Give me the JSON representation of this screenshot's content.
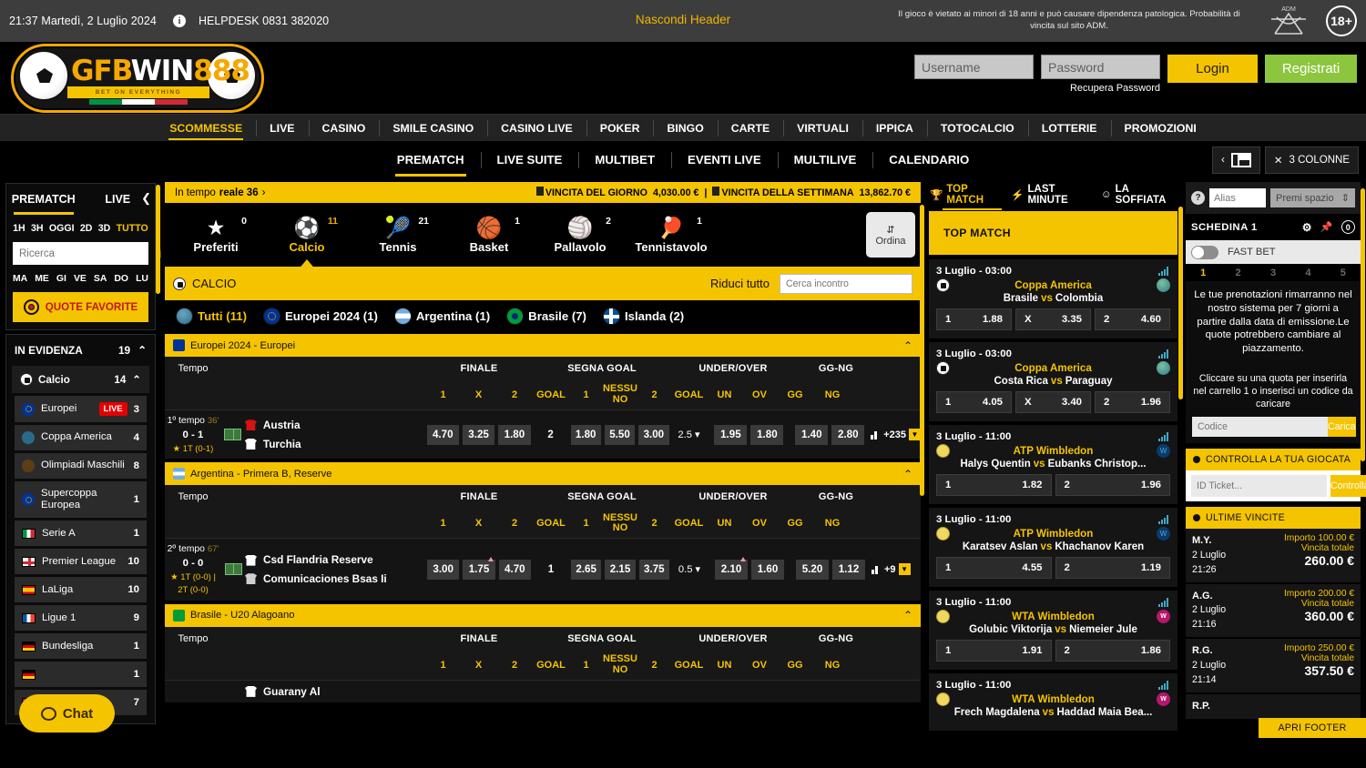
{
  "topbar": {
    "clock": "21:37 Martedì, 2 Luglio 2024",
    "info_icon": "info-icon",
    "helpdesk": "HELPDESK 0831 382020",
    "hide_header": "Nascondi Header",
    "disclaimer": "Il gioco è vietato ai minori di 18 anni e può causare dipendenza patologica. Probabilità di vincita sul sito ADM.",
    "adm_label": "ADM",
    "age_badge": "18+"
  },
  "header": {
    "logo": {
      "part1": "GFB",
      "part2": "WIN",
      "part3": "888",
      "tagline": "BET ON EVERYTHING"
    },
    "login": {
      "username_placeholder": "Username",
      "password_placeholder": "Password",
      "recover": "Recupera Password",
      "login_label": "Login",
      "register_label": "Registrati"
    }
  },
  "mainnav": {
    "items": [
      {
        "label": "SCOMMESSE",
        "active": true
      },
      {
        "label": "LIVE",
        "active": false
      },
      {
        "label": "CASINO",
        "active": false
      },
      {
        "label": "SMILE CASINO",
        "active": false
      },
      {
        "label": "CASINO LIVE",
        "active": false
      },
      {
        "label": "POKER",
        "active": false
      },
      {
        "label": "BINGO",
        "active": false
      },
      {
        "label": "CARTE",
        "active": false
      },
      {
        "label": "VIRTUALI",
        "active": false
      },
      {
        "label": "IPPICA",
        "active": false
      },
      {
        "label": "TOTOCALCIO",
        "active": false
      },
      {
        "label": "LOTTERIE",
        "active": false
      },
      {
        "label": "PROMOZIONI",
        "active": false
      }
    ]
  },
  "subnav": {
    "items": [
      {
        "label": "PREMATCH",
        "active": true
      },
      {
        "label": "LIVE SUITE",
        "active": false
      },
      {
        "label": "MULTIBET",
        "active": false
      },
      {
        "label": "EVENTI LIVE",
        "active": false
      },
      {
        "label": "MULTILIVE",
        "active": false
      },
      {
        "label": "CALENDARIO",
        "active": false
      }
    ],
    "prev_arrow": "‹",
    "layout_icon": "layout-icon",
    "columns_label": "3 COLONNE"
  },
  "sidebar": {
    "tabs": [
      {
        "label": "PREMATCH",
        "active": true
      },
      {
        "label": "LIVE",
        "active": false
      }
    ],
    "collapse_icon": "chevron-left-icon",
    "periods": [
      "1H",
      "3H",
      "OGGI",
      "2D",
      "3D",
      "TUTTO"
    ],
    "period_active": "TUTTO",
    "search_placeholder": "Ricerca",
    "days": [
      "MA",
      "ME",
      "GI",
      "VE",
      "SA",
      "DO",
      "LU"
    ],
    "favorites_label": "QUOTE FAVORITE",
    "highlight_title": "IN EVIDENZA",
    "highlight_count": "19",
    "sport": {
      "label": "Calcio",
      "count": "14"
    },
    "leagues": [
      {
        "label": "Europei",
        "count": "3",
        "tag": "LIVE",
        "flag": "eu"
      },
      {
        "label": "Coppa America",
        "count": "4",
        "tag": "",
        "flag": "globe"
      },
      {
        "label": "Olimpiadi Maschili",
        "count": "8",
        "tag": "",
        "flag": "olym"
      },
      {
        "label": "Supercoppa Europea",
        "count": "1",
        "tag": "",
        "flag": "eu"
      },
      {
        "label": "Serie A",
        "count": "1",
        "tag": "",
        "flag": "it"
      },
      {
        "label": "Premier League",
        "count": "10",
        "tag": "",
        "flag": "en"
      },
      {
        "label": "LaLiga",
        "count": "10",
        "tag": "",
        "flag": "es"
      },
      {
        "label": "Ligue 1",
        "count": "9",
        "tag": "",
        "flag": "fr"
      },
      {
        "label": "Bundesliga",
        "count": "1",
        "tag": "",
        "flag": "de"
      },
      {
        "label": "",
        "count": "1",
        "tag": "",
        "flag": "de"
      },
      {
        "label": "",
        "count": "7",
        "tag": "",
        "flag": "no"
      }
    ],
    "chat_label": "Chat"
  },
  "center": {
    "promo": {
      "live_label": "In tempo",
      "live_bold": "reale 36",
      "live_arrow": "›",
      "daily_label": "VINCITA DEL GIORNO",
      "daily_value": "4,030.00 €",
      "weekly_label": "VINCITA DELLA SETTIMANA",
      "weekly_value": "13,862.70 €"
    },
    "sports": [
      {
        "label": "Preferiti",
        "count": "0",
        "icon": "star-icon",
        "active": false
      },
      {
        "label": "Calcio",
        "count": "11",
        "icon": "soccer-ball-icon",
        "active": true
      },
      {
        "label": "Tennis",
        "count": "21",
        "icon": "tennis-ball-icon",
        "active": false
      },
      {
        "label": "Basket",
        "count": "1",
        "icon": "basketball-icon",
        "active": false
      },
      {
        "label": "Pallavolo",
        "count": "2",
        "icon": "volleyball-icon",
        "active": false
      },
      {
        "label": "Tennistavolo",
        "count": "1",
        "icon": "table-tennis-icon",
        "active": false
      }
    ],
    "sort_label": "Ordina",
    "section_title": "CALCIO",
    "reduce_all": "Riduci tutto",
    "match_search_placeholder": "Cerca incontro",
    "countries": [
      {
        "label": "Tutti (11)",
        "flag": "world",
        "active": true
      },
      {
        "label": "Europei 2024 (1)",
        "flag": "eu",
        "active": false
      },
      {
        "label": "Argentina (1)",
        "flag": "ar",
        "active": false
      },
      {
        "label": "Brasile (7)",
        "flag": "br",
        "active": false
      },
      {
        "label": "Islanda (2)",
        "flag": "is",
        "active": false
      }
    ],
    "columns": {
      "tempo": "Tempo",
      "groups": [
        "FINALE",
        "SEGNA GOAL",
        "UNDER/OVER",
        "GG-NG"
      ],
      "sub": [
        "1",
        "X",
        "2",
        "GOAL",
        "1",
        "NESSU NO",
        "2",
        "GOAL",
        "UN",
        "OV",
        "GG",
        "NG"
      ]
    },
    "leagues": [
      {
        "title": "Europei 2024 - Europei",
        "flag": "eu",
        "matches": [
          {
            "period": "1º tempo",
            "minute": "36'",
            "score": "0 - 1",
            "halves": "1T (0-1)",
            "home": "Austria",
            "away": "Turchia",
            "home_shirt": "red",
            "away_shirt": "white",
            "finale": [
              "4.70",
              "3.25",
              "1.80"
            ],
            "segna_goal": "2",
            "segna": [
              "1.80",
              "5.50",
              "3.00"
            ],
            "uo_line": "2.5",
            "uo": [
              "1.95",
              "1.80"
            ],
            "ggng": [
              "1.40",
              "2.80"
            ],
            "more": "+235"
          }
        ]
      },
      {
        "title": "Argentina - Primera B, Reserve",
        "flag": "ar",
        "matches": [
          {
            "period": "2º tempo",
            "minute": "67'",
            "score": "0 - 0",
            "halves": "1T (0-0) | 2T (0-0)",
            "home": "Csd Flandria Reserve",
            "away": "Comunicaciones Bsas Ii",
            "home_shirt": "white",
            "away_shirt": "grey",
            "finale": [
              "3.00",
              "1.75",
              "4.70"
            ],
            "segna_goal": "1",
            "segna": [
              "2.65",
              "2.15",
              "3.75"
            ],
            "uo_line": "0.5",
            "uo": [
              "2.10",
              "1.60"
            ],
            "ggng": [
              "5.20",
              "1.12"
            ],
            "more": "+9"
          }
        ]
      },
      {
        "title": "Brasile - U20 Alagoano",
        "flag": "br",
        "matches": [
          {
            "period": "",
            "minute": "",
            "score": "",
            "halves": "",
            "home": "Guarany Al",
            "away": "",
            "home_shirt": "white",
            "away_shirt": "white",
            "finale": [],
            "segna_goal": "",
            "segna": [],
            "uo_line": "",
            "uo": [],
            "ggng": [],
            "more": ""
          }
        ]
      }
    ]
  },
  "topmatch": {
    "tabs": [
      {
        "label": "TOP MATCH",
        "icon": "trophy-icon",
        "active": true
      },
      {
        "label": "LAST MINUTE",
        "icon": "bolt-icon",
        "active": false
      },
      {
        "label": "LA SOFFIATA",
        "icon": "smiley-icon",
        "active": false
      }
    ],
    "banner": "TOP MATCH",
    "cards": [
      {
        "date": "3 Luglio - 03:00",
        "league": "Coppa America",
        "sport_icon": "soccer-ball-icon",
        "right_icon": "globe-icon",
        "home": "Brasile",
        "away": "Colombia",
        "vs": "vs",
        "odds": [
          {
            "k": "1",
            "v": "1.88"
          },
          {
            "k": "X",
            "v": "3.35"
          },
          {
            "k": "2",
            "v": "4.60"
          }
        ]
      },
      {
        "date": "3 Luglio - 03:00",
        "league": "Coppa America",
        "sport_icon": "soccer-ball-icon",
        "right_icon": "globe-icon",
        "home": "Costa Rica",
        "away": "Paraguay",
        "vs": "vs",
        "odds": [
          {
            "k": "1",
            "v": "4.05"
          },
          {
            "k": "X",
            "v": "3.40"
          },
          {
            "k": "2",
            "v": "1.96"
          }
        ]
      },
      {
        "date": "3 Luglio - 11:00",
        "league": "ATP Wimbledon",
        "sport_icon": "tennis-ball-icon",
        "right_icon": "atp-icon",
        "home": "Halys Quentin",
        "away": "Eubanks Christop...",
        "vs": "vs",
        "odds": [
          {
            "k": "1",
            "v": "1.82"
          },
          {
            "k": "2",
            "v": "1.96"
          }
        ]
      },
      {
        "date": "3 Luglio - 11:00",
        "league": "ATP Wimbledon",
        "sport_icon": "tennis-ball-icon",
        "right_icon": "atp-icon",
        "home": "Karatsev Aslan",
        "away": "Khachanov Karen",
        "vs": "vs",
        "odds": [
          {
            "k": "1",
            "v": "4.55"
          },
          {
            "k": "2",
            "v": "1.19"
          }
        ]
      },
      {
        "date": "3 Luglio - 11:00",
        "league": "WTA Wimbledon",
        "sport_icon": "tennis-ball-icon",
        "right_icon": "wta-icon",
        "home": "Golubic Viktorija",
        "away": "Niemeier Jule",
        "vs": "vs",
        "odds": [
          {
            "k": "1",
            "v": "1.91"
          },
          {
            "k": "2",
            "v": "1.86"
          }
        ]
      },
      {
        "date": "3 Luglio - 11:00",
        "league": "WTA Wimbledon",
        "sport_icon": "tennis-ball-icon",
        "right_icon": "wta-icon",
        "home": "Frech Magdalena",
        "away": "Haddad Maia Bea...",
        "vs": "vs",
        "odds": []
      }
    ]
  },
  "betslip": {
    "help_icon": "question-icon",
    "alias_placeholder": "Alias",
    "premi_spazio": "Premi spazio",
    "schedina_title": "SCHEDINA 1",
    "gear_icon": "gear-icon",
    "pin_icon": "pin-icon",
    "cart_count": "0",
    "fast_bet": "FAST BET",
    "slip_numbers": [
      "1",
      "2",
      "3",
      "4",
      "5"
    ],
    "slip_active": "1",
    "message": "Le tue prenotazioni rimarranno nel nostro sistema per 7 giorni a partire dalla data di emissione.Le quote potrebbero cambiare al piazzamento.",
    "message2": "Cliccare su una quota per inserirla nel carrello 1 o inserisci un codice da caricare",
    "code_placeholder": "Codice",
    "code_button": "Carica",
    "check_title": "CONTROLLA LA TUA GIOCATA",
    "ticket_placeholder": "ID Ticket...",
    "ticket_button": "Controlla",
    "wins_title": "ULTIME VINCITE",
    "wins": [
      {
        "initials": "M.Y.",
        "date": "2 Luglio",
        "time": "21:26",
        "stake_label": "Importo 100.00 €",
        "total_label": "Vincita totale",
        "amount": "260.00 €"
      },
      {
        "initials": "A.G.",
        "date": "2 Luglio",
        "time": "21:16",
        "stake_label": "Importo 200.00 €",
        "total_label": "Vincita totale",
        "amount": "360.00 €"
      },
      {
        "initials": "R.G.",
        "date": "2 Luglio",
        "time": "21:14",
        "stake_label": "Importo 250.00 €",
        "total_label": "Vincita totale",
        "amount": "357.50 €"
      },
      {
        "initials": "R.P.",
        "date": "",
        "time": "",
        "stake_label": "",
        "total_label": "",
        "amount": ""
      }
    ],
    "footer_button": "APRI FOOTER"
  },
  "colors": {
    "accent": "#f5c400",
    "green": "#8cc63f",
    "live_red": "#e40000",
    "dark": "#000000",
    "panel": "#151515"
  }
}
